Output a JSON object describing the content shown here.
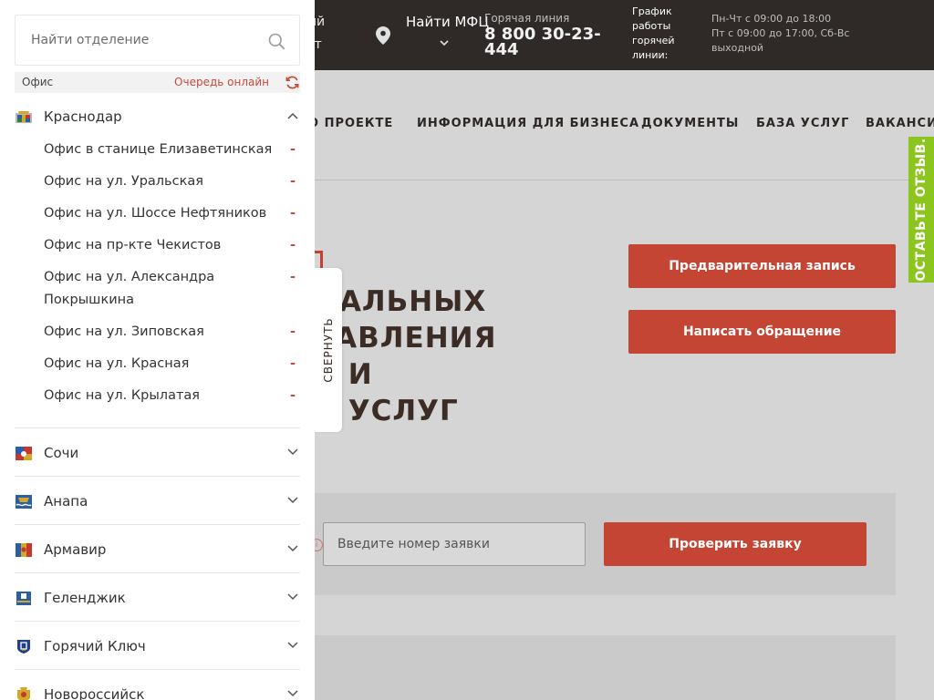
{
  "header": {
    "cabinet_fragment_1": "ый",
    "cabinet_fragment_2": "ет",
    "find_mfc": "Найти МФЦ",
    "hotline_label": "Горячая линия",
    "hotline_number": "8 800 30-23-444",
    "schedule_label": "График работы горячей линии:",
    "schedule_weekdays": "Пн-Чт с 09:00 до 18:00",
    "schedule_friday": "Пт с 09:00 до 17:00, Сб-Вс",
    "schedule_weekend": "выходной"
  },
  "nav": {
    "items": [
      "О ПРОЕКТЕ",
      "ИНФОРМАЦИЯ ДЛЯ БИЗНЕСА",
      "ДОКУМЕНТЫ",
      "БАЗА УСЛУГ",
      "ВАКАНСИИ"
    ]
  },
  "hero": {
    "title_fragment": "НАЛЬНЫХ\nТАВЛЕНИЯ\nХ И\nХ УСЛУГ"
  },
  "actions": {
    "pre_registration": "Предварительная запись",
    "write_appeal": "Написать обращение"
  },
  "application_check": {
    "info_icon": "i",
    "placeholder": "Введите номер заявки",
    "button": "Проверить заявку"
  },
  "feedback_tab": "ОСТАВЬТЕ ОТЗЫВ.",
  "panel": {
    "search_placeholder": "Найти отделение",
    "filter_office": "Офис",
    "filter_queue": "Очередь онлайн",
    "collapse_label": "СВЕРНУТЬ",
    "expanded_city": {
      "name": "Краснодар",
      "offices": [
        {
          "name": "Офис в станице Елизаветинская",
          "status": "-"
        },
        {
          "name": "Офис на ул. Уральская",
          "status": "-"
        },
        {
          "name": "Офис на ул. Шоссе Нефтяников",
          "status": "-"
        },
        {
          "name": "Офис на пр-кте Чекистов",
          "status": "-"
        },
        {
          "name": "Офис на ул. Александра Покрышкина",
          "status": "-"
        },
        {
          "name": "Офис на ул. Зиповская",
          "status": "-"
        },
        {
          "name": "Офис на ул. Красная",
          "status": "-"
        },
        {
          "name": "Офис на ул. Крылатая",
          "status": "-"
        }
      ]
    },
    "cities": [
      {
        "name": "Сочи",
        "icon": "sochi-coat-of-arms"
      },
      {
        "name": "Анапа",
        "icon": "anapa-coat-of-arms"
      },
      {
        "name": "Армавир",
        "icon": "armavir-coat-of-arms"
      },
      {
        "name": "Геленджик",
        "icon": "gelendzhik-coat-of-arms"
      },
      {
        "name": "Горячий Ключ",
        "icon": "goryachy-klyuch-coat-of-arms"
      },
      {
        "name": "Новороссийск",
        "icon": "novorossiysk-coat-of-arms"
      }
    ]
  },
  "colors": {
    "accent_red": "#c44533",
    "header_dark": "#2f2a28",
    "feedback_green": "#8bc51e"
  }
}
